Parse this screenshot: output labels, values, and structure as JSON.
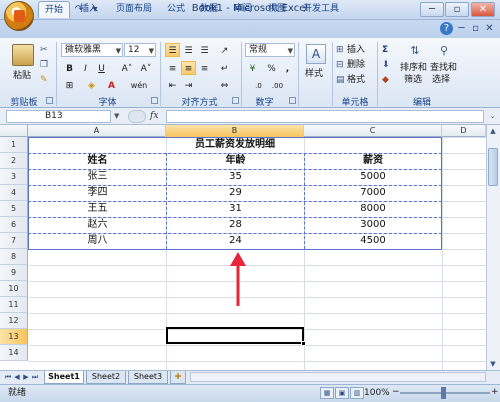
{
  "window": {
    "title": "Book1 - Microsoft Excel",
    "minimize": "─",
    "restore": "▫",
    "close": "✕"
  },
  "quick_access": [
    "💾",
    "↶",
    "↷",
    "▾"
  ],
  "tabs": [
    "开始",
    "插入",
    "页面布局",
    "公式",
    "数据",
    "审阅",
    "视图",
    "开发工具"
  ],
  "tab_icons": [
    "?",
    "─",
    "▫",
    "✕"
  ],
  "ribbon": {
    "clipboard": {
      "paste_label": "粘贴",
      "group_label": "剪贴板"
    },
    "font": {
      "font_name": "微软雅黑",
      "font_size": "12",
      "bold": "B",
      "italic": "I",
      "underline": "U",
      "grow": "A˄",
      "shrink": "A˅",
      "wen": "wén",
      "group_label": "字体"
    },
    "alignment": {
      "group_label": "对齐方式"
    },
    "number": {
      "format": "常规",
      "percent": "%",
      "comma": ",",
      "group_label": "数字"
    },
    "styles": {
      "label": "样式"
    },
    "cells": {
      "insert": "插入",
      "delete": "删除",
      "format": "格式",
      "group_label": "单元格"
    },
    "editing": {
      "sigma": "Σ",
      "sort": "排序和",
      "sort2": "筛选",
      "find": "查找和",
      "find2": "选择",
      "group_label": "编辑"
    }
  },
  "formula_bar": {
    "name_box": "B13",
    "fx": "fx",
    "value": ""
  },
  "columns": [
    "A",
    "B",
    "C",
    "D"
  ],
  "rows": [
    "1",
    "2",
    "3",
    "4",
    "5",
    "6",
    "7",
    "8",
    "9",
    "10",
    "11",
    "12",
    "13",
    "14"
  ],
  "table": {
    "title": "员工薪资发放明细",
    "headers": [
      "姓名",
      "年龄",
      "薪资"
    ],
    "rows": [
      [
        "张三",
        "35",
        "5000"
      ],
      [
        "李四",
        "29",
        "7000"
      ],
      [
        "王五",
        "31",
        "8000"
      ],
      [
        "赵六",
        "28",
        "3000"
      ],
      [
        "周八",
        "24",
        "4500"
      ]
    ]
  },
  "selected_cell": "B13",
  "sheets": [
    "Sheet1",
    "Sheet2",
    "Sheet3"
  ],
  "active_sheet": "Sheet1",
  "status": {
    "mode": "就绪",
    "zoom": "100%"
  },
  "colors": {
    "accent": "#5e72c9",
    "ribbon": "#dbe6f4",
    "annotation": "#e8253a"
  }
}
